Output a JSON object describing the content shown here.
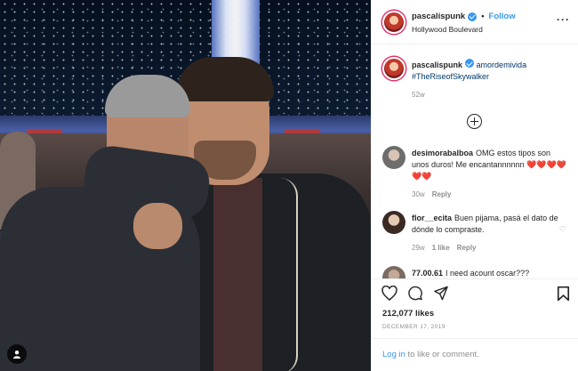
{
  "post": {
    "username": "pascalispunk",
    "follow_label": "Follow",
    "separator": "•",
    "location": "Hollywood Boulevard",
    "more_icon": "more-horizontal-icon",
    "tag_icon": "user-tag-icon"
  },
  "caption": {
    "username": "pascalispunk",
    "mention": "amordemivida",
    "hashtag": "#TheRiseofSkywalker",
    "age": "52w"
  },
  "comments": [
    {
      "username": "desimorabalboa",
      "text": "OMG estos tipos son unos duros! Me encantannnnnn",
      "emoji": "❤️❤️❤️❤️❤️❤️",
      "age": "30w",
      "reply": "Reply"
    },
    {
      "username": "flor__ecita",
      "text": "Buen pijama, pasá el dato de dónde lo compraste.",
      "age": "29w",
      "likes": "1 like",
      "reply": "Reply"
    },
    {
      "username": "77.00.61",
      "text": "I need acount oscar???"
    }
  ],
  "actions": {
    "like_icon": "heart-icon",
    "comment_icon": "comment-icon",
    "share_icon": "share-icon",
    "save_icon": "bookmark-icon",
    "likes": "212,077 likes",
    "date": "DECEMBER 17, 2019"
  },
  "login": {
    "link": "Log in",
    "rest": " to like or comment."
  },
  "colors": {
    "link_blue": "#3897f0",
    "text": "#262626",
    "muted": "#8e8e8e",
    "heart_red": "#ed4956"
  }
}
